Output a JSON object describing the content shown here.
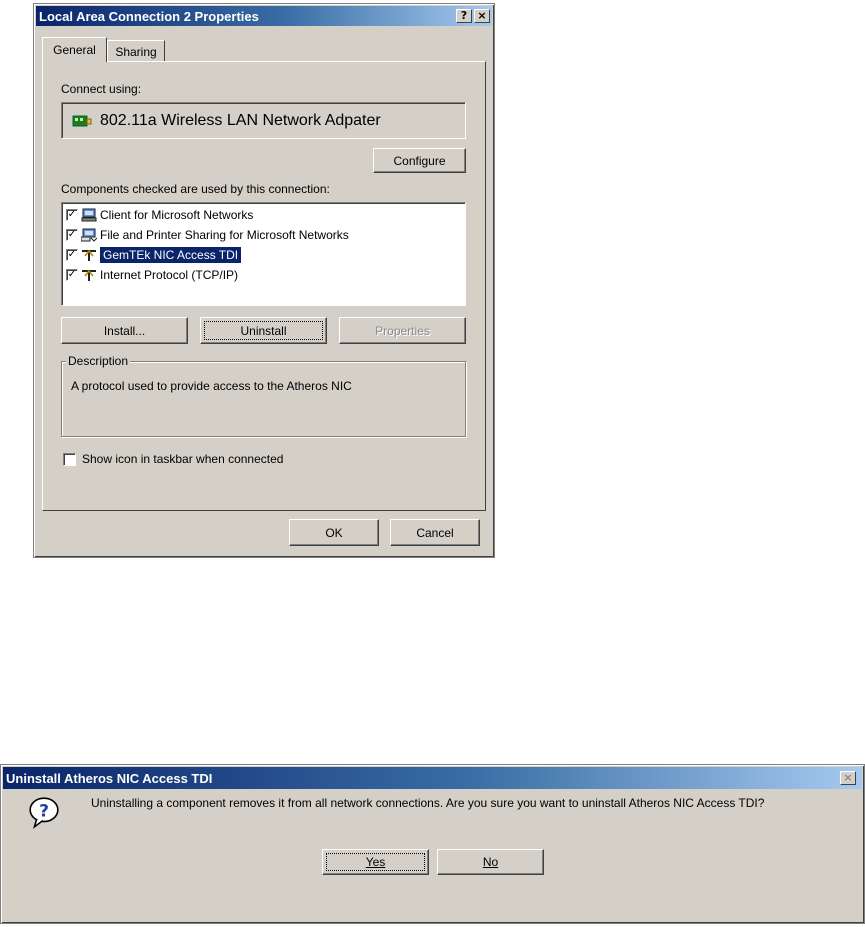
{
  "properties_dialog": {
    "title": "Local Area Connection 2 Properties",
    "help_button": "?",
    "close_button": "×",
    "tabs": [
      {
        "label": "General",
        "selected": true
      },
      {
        "label": "Sharing",
        "selected": false
      }
    ],
    "connect_using_label": "Connect using:",
    "adapter_name": "802.11a Wireless LAN Network Adpater",
    "configure_button": "Configure",
    "components_label": "Components checked are used by this connection:",
    "components": [
      {
        "label": "Client for Microsoft Networks",
        "checked": true,
        "icon": "network-client-icon",
        "selected": false
      },
      {
        "label": "File and Printer Sharing for Microsoft Networks",
        "checked": true,
        "icon": "file-printer-sharing-icon",
        "selected": false
      },
      {
        "label": "GemTEk NIC Access TDI",
        "checked": true,
        "icon": "protocol-icon",
        "selected": true
      },
      {
        "label": "Internet Protocol (TCP/IP)",
        "checked": true,
        "icon": "protocol-icon",
        "selected": false
      }
    ],
    "install_button": "Install...",
    "uninstall_button": "Uninstall",
    "properties_button": "Properties",
    "description_title": "Description",
    "description_text": "A protocol used to provide access to the Atheros NIC",
    "show_icon_label": "Show icon in taskbar when connected",
    "show_icon_checked": false,
    "ok_button": "OK",
    "cancel_button": "Cancel"
  },
  "uninstall_dialog": {
    "title": "Uninstall Atheros NIC Access TDI",
    "close_button": "×",
    "message": "Uninstalling a component removes it from all network connections. Are you sure you want to uninstall Atheros NIC Access TDI?",
    "icon": "question-icon",
    "yes_button": "Yes",
    "no_button": "No"
  },
  "colors": {
    "face": "#d4d0c8",
    "title_active": "#0a246a",
    "title_gradient_end": "#a6caf0",
    "selection": "#0a246a"
  }
}
